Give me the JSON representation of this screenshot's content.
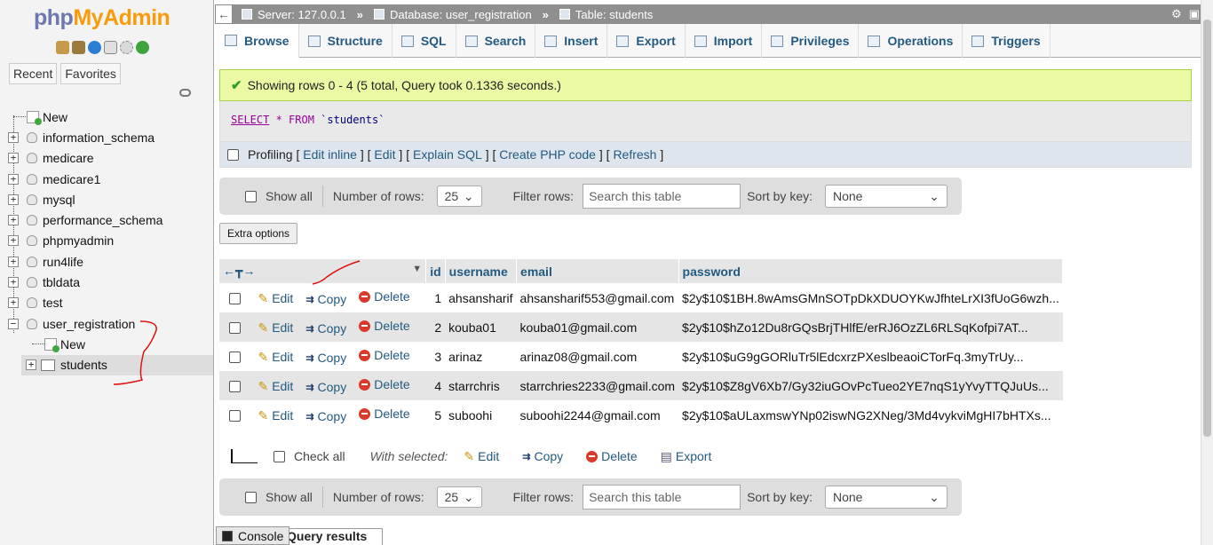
{
  "logo": {
    "part1": "php",
    "part2": "MyAdmin"
  },
  "nav": {
    "recent": "Recent",
    "favorites": "Favorites",
    "tree": [
      {
        "label": "New"
      },
      {
        "label": "information_schema"
      },
      {
        "label": "medicare"
      },
      {
        "label": "medicare1"
      },
      {
        "label": "mysql"
      },
      {
        "label": "performance_schema"
      },
      {
        "label": "phpmyadmin"
      },
      {
        "label": "run4life"
      },
      {
        "label": "tbldata"
      },
      {
        "label": "test"
      },
      {
        "label": "user_registration"
      }
    ],
    "children": [
      {
        "label": "New"
      },
      {
        "label": "students"
      }
    ]
  },
  "breadcrumb": {
    "server": "Server: 127.0.0.1",
    "database": "Database: user_registration",
    "table": "Table: students",
    "sep": "»"
  },
  "tabs": [
    {
      "label": "Browse"
    },
    {
      "label": "Structure"
    },
    {
      "label": "SQL"
    },
    {
      "label": "Search"
    },
    {
      "label": "Insert"
    },
    {
      "label": "Export"
    },
    {
      "label": "Import"
    },
    {
      "label": "Privileges"
    },
    {
      "label": "Operations"
    },
    {
      "label": "Triggers"
    }
  ],
  "message": "Showing rows 0 - 4 (5 total, Query took 0.1336 seconds.)",
  "sql": {
    "select": "SELECT",
    "star": " * ",
    "from": "FROM",
    "table": " `students`"
  },
  "profiling": {
    "label": "Profiling",
    "links": [
      "Edit inline",
      "Edit",
      "Explain SQL",
      "Create PHP code",
      "Refresh"
    ]
  },
  "navbar": {
    "show_all": "Show all",
    "num_rows_label": "Number of rows:",
    "num_rows_value": "25",
    "filter_label": "Filter rows:",
    "filter_placeholder": "Search this table",
    "sort_label": "Sort by key:",
    "sort_value": "None"
  },
  "extra_options": "Extra options",
  "table": {
    "columns": [
      "id",
      "username",
      "email",
      "password"
    ],
    "actions": {
      "edit": "Edit",
      "copy": "Copy",
      "delete": "Delete"
    },
    "rows": [
      {
        "id": "1",
        "username": "ahsansharif",
        "email": "ahsansharif553@gmail.com",
        "password": "$2y$10$1BH.8wAmsGMnSOTpDkXDUOYKwJfhteLrXI3fUoG6wzh..."
      },
      {
        "id": "2",
        "username": "kouba01",
        "email": "kouba01@gmail.com",
        "password": "$2y$10$hZo12Du8rGQsBrjTHlfE/erRJ6OzZL6RLSqKofpi7AT..."
      },
      {
        "id": "3",
        "username": "arinaz",
        "email": "arinaz08@gmail.com",
        "password": "$2y$10$uG9gGORluTr5lEdcxrzPXeslbeaoiCTorFq.3myTrUy..."
      },
      {
        "id": "4",
        "username": "starrchris",
        "email": "starrchries2233@gmail.com",
        "password": "$2y$10$Z8gV6Xb7/Gy32iuGOvPcTueo2YE7nqS1yYvyTTQJuUs..."
      },
      {
        "id": "5",
        "username": "suboohi",
        "email": "suboohi2244@gmail.com",
        "password": "$2y$10$aULaxmswYNp02iswNG2XNeg/3Md4vykviMgHI7bHTXs..."
      }
    ]
  },
  "bulk": {
    "check_all": "Check all",
    "with_selected": "With selected:",
    "edit": "Edit",
    "copy": "Copy",
    "delete": "Delete",
    "export": "Export"
  },
  "console": "Console",
  "query_results_tab": "Query results operations"
}
